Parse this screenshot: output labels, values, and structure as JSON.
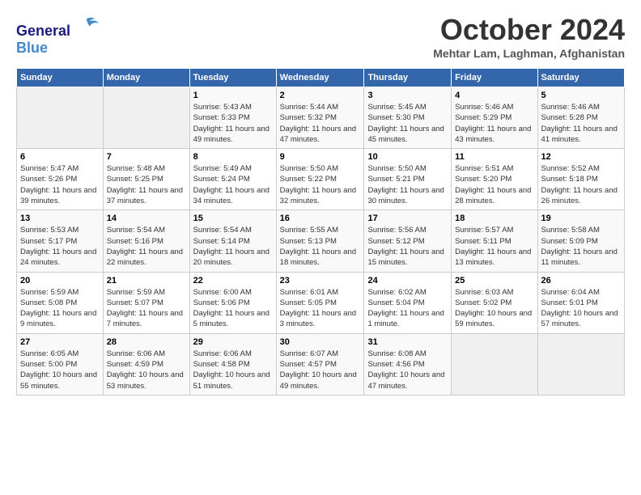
{
  "header": {
    "logo_line1": "General",
    "logo_line2": "Blue",
    "month_title": "October 2024",
    "location": "Mehtar Lam, Laghman, Afghanistan"
  },
  "days_of_week": [
    "Sunday",
    "Monday",
    "Tuesday",
    "Wednesday",
    "Thursday",
    "Friday",
    "Saturday"
  ],
  "weeks": [
    [
      {
        "day": "",
        "empty": true
      },
      {
        "day": "",
        "empty": true
      },
      {
        "day": "1",
        "sunrise": "5:43 AM",
        "sunset": "5:33 PM",
        "daylight": "11 hours and 49 minutes."
      },
      {
        "day": "2",
        "sunrise": "5:44 AM",
        "sunset": "5:32 PM",
        "daylight": "11 hours and 47 minutes."
      },
      {
        "day": "3",
        "sunrise": "5:45 AM",
        "sunset": "5:30 PM",
        "daylight": "11 hours and 45 minutes."
      },
      {
        "day": "4",
        "sunrise": "5:46 AM",
        "sunset": "5:29 PM",
        "daylight": "11 hours and 43 minutes."
      },
      {
        "day": "5",
        "sunrise": "5:46 AM",
        "sunset": "5:28 PM",
        "daylight": "11 hours and 41 minutes."
      }
    ],
    [
      {
        "day": "6",
        "sunrise": "5:47 AM",
        "sunset": "5:26 PM",
        "daylight": "11 hours and 39 minutes."
      },
      {
        "day": "7",
        "sunrise": "5:48 AM",
        "sunset": "5:25 PM",
        "daylight": "11 hours and 37 minutes."
      },
      {
        "day": "8",
        "sunrise": "5:49 AM",
        "sunset": "5:24 PM",
        "daylight": "11 hours and 34 minutes."
      },
      {
        "day": "9",
        "sunrise": "5:50 AM",
        "sunset": "5:22 PM",
        "daylight": "11 hours and 32 minutes."
      },
      {
        "day": "10",
        "sunrise": "5:50 AM",
        "sunset": "5:21 PM",
        "daylight": "11 hours and 30 minutes."
      },
      {
        "day": "11",
        "sunrise": "5:51 AM",
        "sunset": "5:20 PM",
        "daylight": "11 hours and 28 minutes."
      },
      {
        "day": "12",
        "sunrise": "5:52 AM",
        "sunset": "5:18 PM",
        "daylight": "11 hours and 26 minutes."
      }
    ],
    [
      {
        "day": "13",
        "sunrise": "5:53 AM",
        "sunset": "5:17 PM",
        "daylight": "11 hours and 24 minutes."
      },
      {
        "day": "14",
        "sunrise": "5:54 AM",
        "sunset": "5:16 PM",
        "daylight": "11 hours and 22 minutes."
      },
      {
        "day": "15",
        "sunrise": "5:54 AM",
        "sunset": "5:14 PM",
        "daylight": "11 hours and 20 minutes."
      },
      {
        "day": "16",
        "sunrise": "5:55 AM",
        "sunset": "5:13 PM",
        "daylight": "11 hours and 18 minutes."
      },
      {
        "day": "17",
        "sunrise": "5:56 AM",
        "sunset": "5:12 PM",
        "daylight": "11 hours and 15 minutes."
      },
      {
        "day": "18",
        "sunrise": "5:57 AM",
        "sunset": "5:11 PM",
        "daylight": "11 hours and 13 minutes."
      },
      {
        "day": "19",
        "sunrise": "5:58 AM",
        "sunset": "5:09 PM",
        "daylight": "11 hours and 11 minutes."
      }
    ],
    [
      {
        "day": "20",
        "sunrise": "5:59 AM",
        "sunset": "5:08 PM",
        "daylight": "11 hours and 9 minutes."
      },
      {
        "day": "21",
        "sunrise": "5:59 AM",
        "sunset": "5:07 PM",
        "daylight": "11 hours and 7 minutes."
      },
      {
        "day": "22",
        "sunrise": "6:00 AM",
        "sunset": "5:06 PM",
        "daylight": "11 hours and 5 minutes."
      },
      {
        "day": "23",
        "sunrise": "6:01 AM",
        "sunset": "5:05 PM",
        "daylight": "11 hours and 3 minutes."
      },
      {
        "day": "24",
        "sunrise": "6:02 AM",
        "sunset": "5:04 PM",
        "daylight": "11 hours and 1 minute."
      },
      {
        "day": "25",
        "sunrise": "6:03 AM",
        "sunset": "5:02 PM",
        "daylight": "10 hours and 59 minutes."
      },
      {
        "day": "26",
        "sunrise": "6:04 AM",
        "sunset": "5:01 PM",
        "daylight": "10 hours and 57 minutes."
      }
    ],
    [
      {
        "day": "27",
        "sunrise": "6:05 AM",
        "sunset": "5:00 PM",
        "daylight": "10 hours and 55 minutes."
      },
      {
        "day": "28",
        "sunrise": "6:06 AM",
        "sunset": "4:59 PM",
        "daylight": "10 hours and 53 minutes."
      },
      {
        "day": "29",
        "sunrise": "6:06 AM",
        "sunset": "4:58 PM",
        "daylight": "10 hours and 51 minutes."
      },
      {
        "day": "30",
        "sunrise": "6:07 AM",
        "sunset": "4:57 PM",
        "daylight": "10 hours and 49 minutes."
      },
      {
        "day": "31",
        "sunrise": "6:08 AM",
        "sunset": "4:56 PM",
        "daylight": "10 hours and 47 minutes."
      },
      {
        "day": "",
        "empty": true
      },
      {
        "day": "",
        "empty": true
      }
    ]
  ]
}
